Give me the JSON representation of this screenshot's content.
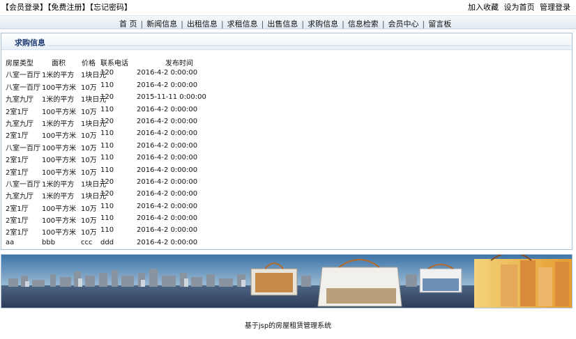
{
  "top": {
    "left_links": [
      "【会员登录】",
      "【免费注册】",
      "【忘记密码】"
    ],
    "right_links": [
      "加入收藏",
      "设为首页",
      "管理登录"
    ]
  },
  "nav": {
    "items": [
      "首 页",
      "新闻信息",
      "出租信息",
      "求租信息",
      "出售信息",
      "求购信息",
      "信息检索",
      "会员中心",
      "留言板"
    ]
  },
  "panel": {
    "title": "求购信息",
    "headers": [
      "房屋类型",
      "面积",
      "价格",
      "联系电话",
      "发布时间"
    ],
    "rows": [
      [
        "八室一百厅",
        "1米的平方",
        "1块日元",
        "120",
        "2016-4-2 0:00:00"
      ],
      [
        "八室一百厅",
        "100平方米",
        "10万",
        "110",
        "2016-4-2 0:00:00"
      ],
      [
        "九室九厅",
        "1米的平方",
        "1块日元",
        "120",
        "2015-11-11 0:00:00"
      ],
      [
        "2室1厅",
        "100平方米",
        "10万",
        "110",
        "2016-4-2 0:00:00"
      ],
      [
        "九室九厅",
        "1米的平方",
        "1块日元",
        "120",
        "2016-4-2 0:00:00"
      ],
      [
        "2室1厅",
        "100平方米",
        "10万",
        "110",
        "2016-4-2 0:00:00"
      ],
      [
        "八室一百厅",
        "100平方米",
        "10万",
        "110",
        "2016-4-2 0:00:00"
      ],
      [
        "2室1厅",
        "100平方米",
        "10万",
        "110",
        "2016-4-2 0:00:00"
      ],
      [
        "2室1厅",
        "100平方米",
        "10万",
        "110",
        "2016-4-2 0:00:00"
      ],
      [
        "八室一百厅",
        "1米的平方",
        "1块日元",
        "120",
        "2016-4-2 0:00:00"
      ],
      [
        "九室九厅",
        "1米的平方",
        "1块日元",
        "120",
        "2016-4-2 0:00:00"
      ],
      [
        "2室1厅",
        "100平方米",
        "10万",
        "110",
        "2016-4-2 0:00:00"
      ],
      [
        "2室1厅",
        "100平方米",
        "10万",
        "110",
        "2016-4-2 0:00:00"
      ],
      [
        "2室1厅",
        "100平方米",
        "10万",
        "110",
        "2016-4-2 0:00:00"
      ],
      [
        "aa",
        "bbb",
        "ccc",
        "ddd",
        "2016-4-2 0:00:00"
      ]
    ]
  },
  "footer": {
    "text": "基于jsp的房屋租赁管理系统"
  }
}
